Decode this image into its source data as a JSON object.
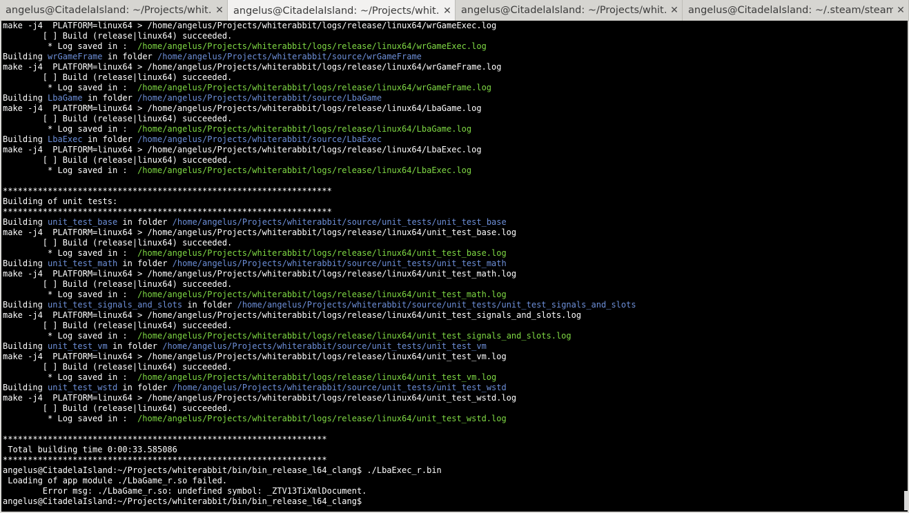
{
  "tabs": [
    {
      "label": "angelus@CitadelaIsland: ~/Projects/whit…",
      "active": false
    },
    {
      "label": "angelus@CitadelaIsland: ~/Projects/whit…",
      "active": true
    },
    {
      "label": "angelus@CitadelaIsland: ~/Projects/whit…",
      "active": false
    },
    {
      "label": "angelus@CitadelaIsland: ~/.steam/steam…",
      "active": false
    }
  ],
  "close_glyph": "✕",
  "colors": {
    "background": "#000000",
    "path_blue": "#6d8fd8",
    "log_green": "#7fd944",
    "text": "#ffffff"
  },
  "terminal_lines": [
    [
      {
        "t": "make -j4  PLATFORM=linux64 > /home/angelus/Projects/whiterabbit/logs/release/linux64/wrGameExec.log"
      }
    ],
    [
      {
        "t": "        [ ] Build (release|linux64) succeeded."
      }
    ],
    [
      {
        "t": "         * Log saved in :  "
      },
      {
        "t": "/home/angelus/Projects/whiterabbit/logs/release/linux64/wrGameExec.log",
        "c": "green"
      }
    ],
    [
      {
        "t": "Building "
      },
      {
        "t": "wrGameFrame",
        "c": "blue"
      },
      {
        "t": " in folder "
      },
      {
        "t": "/home/angelus/Projects/whiterabbit/source/wrGameFrame",
        "c": "blue"
      }
    ],
    [
      {
        "t": "make -j4  PLATFORM=linux64 > /home/angelus/Projects/whiterabbit/logs/release/linux64/wrGameFrame.log"
      }
    ],
    [
      {
        "t": "        [ ] Build (release|linux64) succeeded."
      }
    ],
    [
      {
        "t": "         * Log saved in :  "
      },
      {
        "t": "/home/angelus/Projects/whiterabbit/logs/release/linux64/wrGameFrame.log",
        "c": "green"
      }
    ],
    [
      {
        "t": "Building "
      },
      {
        "t": "LbaGame",
        "c": "blue"
      },
      {
        "t": " in folder "
      },
      {
        "t": "/home/angelus/Projects/whiterabbit/source/LbaGame",
        "c": "blue"
      }
    ],
    [
      {
        "t": "make -j4  PLATFORM=linux64 > /home/angelus/Projects/whiterabbit/logs/release/linux64/LbaGame.log"
      }
    ],
    [
      {
        "t": "        [ ] Build (release|linux64) succeeded."
      }
    ],
    [
      {
        "t": "         * Log saved in :  "
      },
      {
        "t": "/home/angelus/Projects/whiterabbit/logs/release/linux64/LbaGame.log",
        "c": "green"
      }
    ],
    [
      {
        "t": "Building "
      },
      {
        "t": "LbaExec",
        "c": "blue"
      },
      {
        "t": " in folder "
      },
      {
        "t": "/home/angelus/Projects/whiterabbit/source/LbaExec",
        "c": "blue"
      }
    ],
    [
      {
        "t": "make -j4  PLATFORM=linux64 > /home/angelus/Projects/whiterabbit/logs/release/linux64/LbaExec.log"
      }
    ],
    [
      {
        "t": "        [ ] Build (release|linux64) succeeded."
      }
    ],
    [
      {
        "t": "         * Log saved in :  "
      },
      {
        "t": "/home/angelus/Projects/whiterabbit/logs/release/linux64/LbaExec.log",
        "c": "green"
      }
    ],
    [
      {
        "t": ""
      }
    ],
    [
      {
        "t": "******************************************************************"
      }
    ],
    [
      {
        "t": "Building of unit tests:"
      }
    ],
    [
      {
        "t": "******************************************************************"
      }
    ],
    [
      {
        "t": "Building "
      },
      {
        "t": "unit_test_base",
        "c": "blue"
      },
      {
        "t": " in folder "
      },
      {
        "t": "/home/angelus/Projects/whiterabbit/source/unit_tests/unit_test_base",
        "c": "blue"
      }
    ],
    [
      {
        "t": "make -j4  PLATFORM=linux64 > /home/angelus/Projects/whiterabbit/logs/release/linux64/unit_test_base.log"
      }
    ],
    [
      {
        "t": "        [ ] Build (release|linux64) succeeded."
      }
    ],
    [
      {
        "t": "         * Log saved in :  "
      },
      {
        "t": "/home/angelus/Projects/whiterabbit/logs/release/linux64/unit_test_base.log",
        "c": "green"
      }
    ],
    [
      {
        "t": "Building "
      },
      {
        "t": "unit_test_math",
        "c": "blue"
      },
      {
        "t": " in folder "
      },
      {
        "t": "/home/angelus/Projects/whiterabbit/source/unit_tests/unit_test_math",
        "c": "blue"
      }
    ],
    [
      {
        "t": "make -j4  PLATFORM=linux64 > /home/angelus/Projects/whiterabbit/logs/release/linux64/unit_test_math.log"
      }
    ],
    [
      {
        "t": "        [ ] Build (release|linux64) succeeded."
      }
    ],
    [
      {
        "t": "         * Log saved in :  "
      },
      {
        "t": "/home/angelus/Projects/whiterabbit/logs/release/linux64/unit_test_math.log",
        "c": "green"
      }
    ],
    [
      {
        "t": "Building "
      },
      {
        "t": "unit_test_signals_and_slots",
        "c": "blue"
      },
      {
        "t": " in folder "
      },
      {
        "t": "/home/angelus/Projects/whiterabbit/source/unit_tests/unit_test_signals_and_slots",
        "c": "blue"
      }
    ],
    [
      {
        "t": "make -j4  PLATFORM=linux64 > /home/angelus/Projects/whiterabbit/logs/release/linux64/unit_test_signals_and_slots.log"
      }
    ],
    [
      {
        "t": "        [ ] Build (release|linux64) succeeded."
      }
    ],
    [
      {
        "t": "         * Log saved in :  "
      },
      {
        "t": "/home/angelus/Projects/whiterabbit/logs/release/linux64/unit_test_signals_and_slots.log",
        "c": "green"
      }
    ],
    [
      {
        "t": "Building "
      },
      {
        "t": "unit_test_vm",
        "c": "blue"
      },
      {
        "t": " in folder "
      },
      {
        "t": "/home/angelus/Projects/whiterabbit/source/unit_tests/unit_test_vm",
        "c": "blue"
      }
    ],
    [
      {
        "t": "make -j4  PLATFORM=linux64 > /home/angelus/Projects/whiterabbit/logs/release/linux64/unit_test_vm.log"
      }
    ],
    [
      {
        "t": "        [ ] Build (release|linux64) succeeded."
      }
    ],
    [
      {
        "t": "         * Log saved in :  "
      },
      {
        "t": "/home/angelus/Projects/whiterabbit/logs/release/linux64/unit_test_vm.log",
        "c": "green"
      }
    ],
    [
      {
        "t": "Building "
      },
      {
        "t": "unit_test_wstd",
        "c": "blue"
      },
      {
        "t": " in folder "
      },
      {
        "t": "/home/angelus/Projects/whiterabbit/source/unit_tests/unit_test_wstd",
        "c": "blue"
      }
    ],
    [
      {
        "t": "make -j4  PLATFORM=linux64 > /home/angelus/Projects/whiterabbit/logs/release/linux64/unit_test_wstd.log"
      }
    ],
    [
      {
        "t": "        [ ] Build (release|linux64) succeeded."
      }
    ],
    [
      {
        "t": "         * Log saved in :  "
      },
      {
        "t": "/home/angelus/Projects/whiterabbit/logs/release/linux64/unit_test_wstd.log",
        "c": "green"
      }
    ],
    [
      {
        "t": ""
      }
    ],
    [
      {
        "t": "*****************************************************************"
      }
    ],
    [
      {
        "t": " Total building time 0:00:33.585086"
      }
    ],
    [
      {
        "t": "*****************************************************************"
      }
    ],
    [
      {
        "t": "angelus@CitadelaIsland:~/Projects/whiterabbit/bin/bin_release_l64_clang$ ./LbaExec_r.bin"
      }
    ],
    [
      {
        "t": " Loading of app module ./LbaGame_r.so failed."
      }
    ],
    [
      {
        "t": "        Error msg: ./LbaGame_r.so: undefined symbol: _ZTV13TiXmlDocument."
      }
    ],
    [
      {
        "t": "angelus@CitadelaIsland:~/Projects/whiterabbit/bin/bin_release_l64_clang$ "
      }
    ]
  ]
}
